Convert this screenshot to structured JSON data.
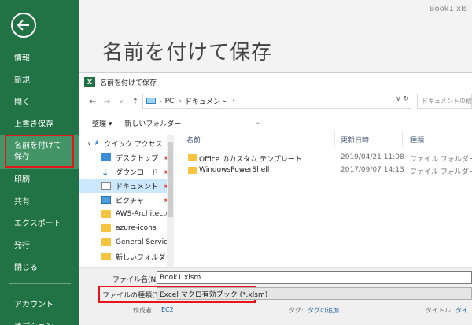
{
  "window": {
    "doc_title": "Book1.xls"
  },
  "sidebar": {
    "items": [
      {
        "label": "情報"
      },
      {
        "label": "新規"
      },
      {
        "label": "開く"
      },
      {
        "label": "上書き保存"
      },
      {
        "label_line1": "名前を付けて",
        "label_line2": "保存"
      },
      {
        "label": "印刷"
      },
      {
        "label": "共有"
      },
      {
        "label": "エクスポート"
      },
      {
        "label": "発行"
      },
      {
        "label": "閉じる"
      },
      {
        "label": "アカウント"
      },
      {
        "label": "オプション"
      }
    ]
  },
  "page_title": "名前を付けて保存",
  "dialog": {
    "title": "名前を付けて保存",
    "address": {
      "segments": [
        "PC",
        "ドキュメント"
      ],
      "separator": "›"
    },
    "search_placeholder": "ドキュメントの検索",
    "toolbar": {
      "organize": "整理 ▾",
      "new_folder": "新しいフォルダー"
    },
    "navpane": {
      "items": [
        {
          "label": "クイック アクセス",
          "icon": "star-icon"
        },
        {
          "label": "デスクトップ",
          "icon": "desktop-icon",
          "pinned": "📌"
        },
        {
          "label": "ダウンロード",
          "icon": "download-icon",
          "pinned": "📌"
        },
        {
          "label": "ドキュメント",
          "icon": "document-icon",
          "pinned": "📌"
        },
        {
          "label": "ピクチャ",
          "icon": "picture-icon",
          "pinned": "📌"
        },
        {
          "label": "AWS-Architectu",
          "icon": "folder-icon"
        },
        {
          "label": "azure-icons",
          "icon": "folder-icon"
        },
        {
          "label": "General Service I",
          "icon": "folder-icon"
        },
        {
          "label": "新しいフォルダー",
          "icon": "folder-icon"
        }
      ]
    },
    "columns": {
      "name": "名前",
      "date": "更新日時",
      "type": "種類"
    },
    "files": [
      {
        "name": "Office のカスタム テンプレート",
        "date": "2019/04/21 11:08",
        "type": "ファイル フォルダー"
      },
      {
        "name": "WindowsPowerShell",
        "date": "2017/09/07 14:13",
        "type": "ファイル フォルダー"
      }
    ],
    "filename_label": "ファイル名(N):",
    "filename_value": "Book1.xlsm",
    "filetype_label": "ファイルの種類(T):",
    "filetype_value": "Excel マクロ有効ブック (*.xlsm)",
    "author_label": "作成者:",
    "author_value": "EC2",
    "tags_label": "タグ:",
    "tags_value": "タグの追加",
    "title_label": "タイトル:",
    "title_value": "タイ"
  },
  "colors": {
    "sidebar": "#217346",
    "sidebar_active": "#439467",
    "highlight": "#e8141b"
  }
}
